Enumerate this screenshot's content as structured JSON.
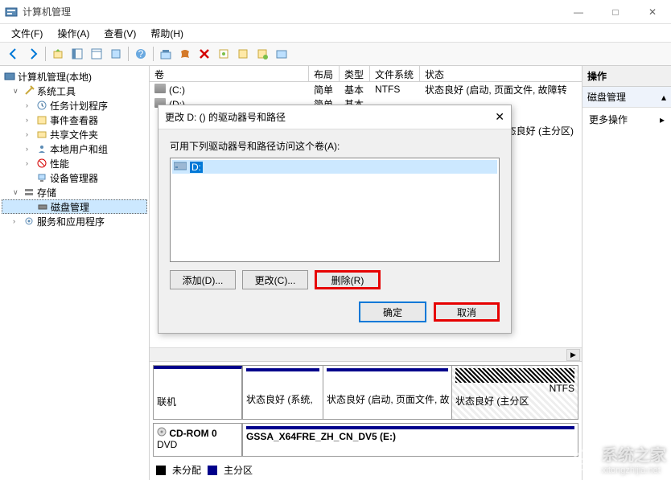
{
  "window": {
    "title": "计算机管理",
    "controls": {
      "minimize": "—",
      "maximize": "□",
      "close": "✕"
    }
  },
  "menu": {
    "file": "文件(F)",
    "action": "操作(A)",
    "view": "查看(V)",
    "help": "帮助(H)"
  },
  "tree": {
    "root": "计算机管理(本地)",
    "system_tools": "系统工具",
    "task_scheduler": "任务计划程序",
    "event_viewer": "事件查看器",
    "shared_folders": "共享文件夹",
    "local_users": "本地用户和组",
    "performance": "性能",
    "device_manager": "设备管理器",
    "storage": "存储",
    "disk_management": "磁盘管理",
    "services": "服务和应用程序"
  },
  "columns": {
    "volume": "卷",
    "layout": "布局",
    "type": "类型",
    "fs": "文件系统",
    "status": "状态"
  },
  "volumes": [
    {
      "name": "(C:)",
      "layout": "简单",
      "type": "基本",
      "fs": "NTFS",
      "status": "状态良好 (启动, 页面文件, 故障转"
    },
    {
      "name": "(D:)",
      "layout": "简单",
      "type": "基本",
      "fs": "",
      "status": "状态良好 (主分区)"
    }
  ],
  "truncated_status": "状态良好 (主分区)",
  "disk_graph": {
    "online": "联机",
    "part1": "状态良好 (系统, ",
    "part2": "状态良好 (启动, 页面文件, 故",
    "part3_fs": "NTFS",
    "part3": "状态良好 (主分区",
    "cdrom": {
      "name": "CD-ROM 0",
      "type": "DVD",
      "label": "GSSA_X64FRE_ZH_CN_DV5  (E:)"
    }
  },
  "legend": {
    "unalloc": "未分配",
    "primary": "主分区"
  },
  "actions": {
    "header": "操作",
    "disk_mgmt": "磁盘管理",
    "more": "更多操作"
  },
  "dialog": {
    "title": "更改 D: () 的驱动器号和路径",
    "message": "可用下列驱动器号和路径访问这个卷(A):",
    "item": "D:",
    "add": "添加(D)...",
    "change": "更改(C)...",
    "remove": "删除(R)",
    "ok": "确定",
    "cancel": "取消"
  },
  "watermark": "系统之家",
  "watermark_url": "xitongzhijia.net"
}
